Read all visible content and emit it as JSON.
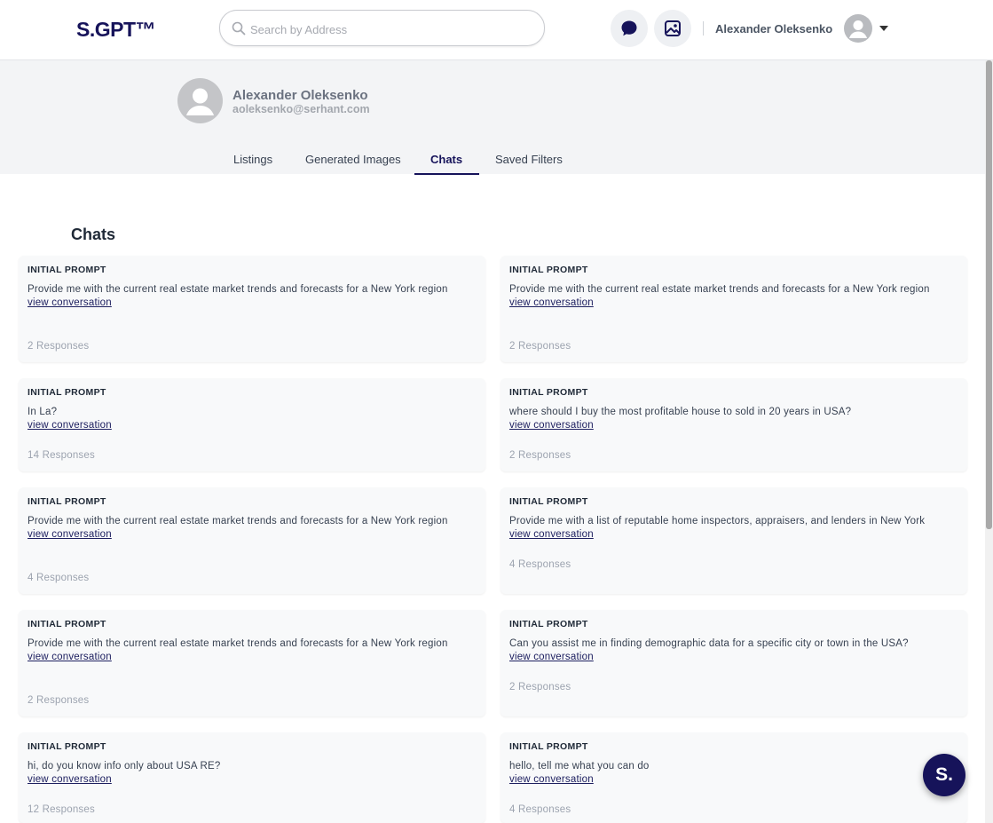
{
  "header": {
    "logo": "S.GPT™",
    "search_placeholder": "Search by Address",
    "user_name": "Alexander Oleksenko"
  },
  "profile": {
    "name": "Alexander Oleksenko",
    "email": "aoleksenko@serhant.com"
  },
  "tabs": [
    {
      "label": "Listings"
    },
    {
      "label": "Generated Images"
    },
    {
      "label": "Chats",
      "active": true
    },
    {
      "label": "Saved Filters"
    }
  ],
  "section_title": "Chats",
  "card_label": "INITIAL PROMPT",
  "link_text": "view conversation",
  "chats": [
    {
      "prompt": "Provide me with the current real estate market trends and forecasts for a New York region",
      "responses": "2 Responses"
    },
    {
      "prompt": "Provide me with the current real estate market trends and forecasts for a New York region",
      "responses": "2 Responses"
    },
    {
      "prompt": "In La?",
      "responses": "14 Responses"
    },
    {
      "prompt": "where should I buy the most profitable house to sold in 20 years in USA?",
      "responses": "2 Responses"
    },
    {
      "prompt": "Provide me with the current real estate market trends and forecasts for a New York region",
      "responses": "4 Responses"
    },
    {
      "prompt": "Provide me with a list of reputable home inspectors, appraisers, and lenders in New York",
      "responses": "4 Responses"
    },
    {
      "prompt": "Provide me with the current real estate market trends and forecasts for a New York region",
      "responses": "2 Responses"
    },
    {
      "prompt": "Can you assist me in finding demographic data for a specific city or town in the USA?",
      "responses": "2 Responses"
    },
    {
      "prompt": "hi, do you know info only about USA RE?",
      "responses": "12 Responses"
    },
    {
      "prompt": "hello, tell me what you can do",
      "responses": "4 Responses"
    }
  ],
  "fab_label": "S.",
  "colors": {
    "brand": "#16135a",
    "background_band": "#f3f4f6",
    "card": "#f8f9fa"
  }
}
